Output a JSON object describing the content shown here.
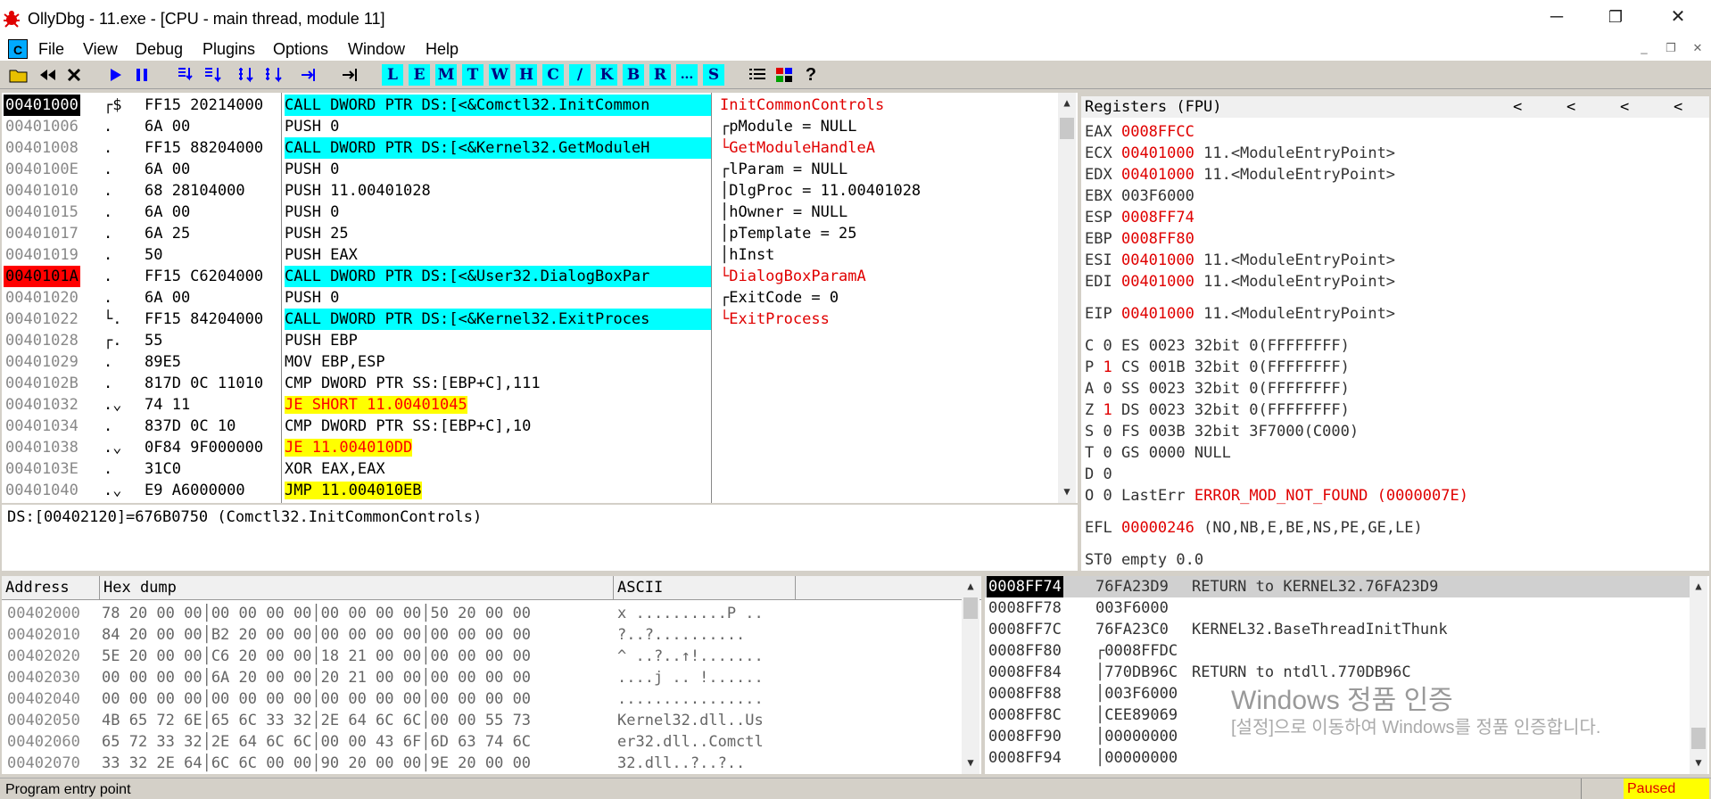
{
  "window": {
    "title": "OllyDbg - 11.exe - [CPU - main thread, module 11]",
    "minimize": "─",
    "restore": "❐",
    "close": "✕"
  },
  "menu": {
    "doc_icon": "C",
    "items": [
      "File",
      "View",
      "Debug",
      "Plugins",
      "Options",
      "Window",
      "Help"
    ],
    "mdi_min": "_",
    "mdi_restore": "❐",
    "mdi_close": "✕"
  },
  "toolbar": {
    "letters": [
      "L",
      "E",
      "M",
      "T",
      "W",
      "H",
      "C",
      "/",
      "K",
      "B",
      "R",
      "...",
      "S"
    ],
    "help": "?"
  },
  "cpu": {
    "rows": [
      {
        "addr": "00401000",
        "br": "┌$",
        "hex": "FF15 20214000",
        "dis": "CALL DWORD PTR DS:[<&Comctl32.InitCommon",
        "cmt": "InitCommonControls",
        "style": "call",
        "sel": true,
        "api": true
      },
      {
        "addr": "00401006",
        "br": ".",
        "hex": "6A 00",
        "dis": "PUSH 0",
        "cmt": "┌pModule = NULL",
        "style": "",
        "api": false
      },
      {
        "addr": "00401008",
        "br": ".",
        "hex": "FF15 88204000",
        "dis": "CALL DWORD PTR DS:[<&Kernel32.GetModuleH",
        "cmt": "└GetModuleHandleA",
        "style": "call",
        "api": true
      },
      {
        "addr": "0040100E",
        "br": ".",
        "hex": "6A 00",
        "dis": "PUSH 0",
        "cmt": "┌lParam = NULL",
        "style": "",
        "api": false
      },
      {
        "addr": "00401010",
        "br": ".",
        "hex": "68 28104000",
        "dis": "PUSH 11.00401028",
        "cmt": "│DlgProc = 11.00401028",
        "style": "",
        "api": false
      },
      {
        "addr": "00401015",
        "br": ".",
        "hex": "6A 00",
        "dis": "PUSH 0",
        "cmt": "│hOwner = NULL",
        "style": "",
        "api": false
      },
      {
        "addr": "00401017",
        "br": ".",
        "hex": "6A 25",
        "dis": "PUSH 25",
        "cmt": "│pTemplate = 25",
        "style": "",
        "api": false
      },
      {
        "addr": "00401019",
        "br": ".",
        "hex": "50",
        "dis": "PUSH EAX",
        "cmt": "│hInst",
        "style": "",
        "api": false
      },
      {
        "addr": "0040101A",
        "br": ".",
        "hex": "FF15 C6204000",
        "dis": "CALL DWORD PTR DS:[<&User32.DialogBoxPar",
        "cmt": "└DialogBoxParamA",
        "style": "call",
        "bp": true,
        "api": true
      },
      {
        "addr": "00401020",
        "br": ".",
        "hex": "6A 00",
        "dis": "PUSH 0",
        "cmt": "┌ExitCode = 0",
        "style": "",
        "api": false
      },
      {
        "addr": "00401022",
        "br": "└.",
        "hex": "FF15 84204000",
        "dis": "CALL DWORD PTR DS:[<&Kernel32.ExitProces",
        "cmt": "└ExitProcess",
        "style": "call",
        "api": true
      },
      {
        "addr": "00401028",
        "br": "┌.",
        "hex": "55",
        "dis": "PUSH EBP",
        "cmt": "",
        "style": "",
        "api": false
      },
      {
        "addr": "00401029",
        "br": ".",
        "hex": "89E5",
        "dis": "MOV EBP,ESP",
        "cmt": "",
        "style": "",
        "api": false
      },
      {
        "addr": "0040102B",
        "br": ".",
        "hex": "817D 0C 11010",
        "dis": "CMP DWORD PTR SS:[EBP+C],111",
        "cmt": "",
        "style": "",
        "api": false
      },
      {
        "addr": "00401032",
        "br": ".⌄",
        "hex": "74 11",
        "dis": "JE SHORT 11.00401045",
        "cmt": "",
        "style": "jcc",
        "api": false
      },
      {
        "addr": "00401034",
        "br": ".",
        "hex": "837D 0C 10",
        "dis": "CMP DWORD PTR SS:[EBP+C],10",
        "cmt": "",
        "style": "",
        "api": false
      },
      {
        "addr": "00401038",
        "br": ".⌄",
        "hex": "0F84 9F000000",
        "dis": "JE 11.004010DD",
        "cmt": "",
        "style": "jcc",
        "api": false
      },
      {
        "addr": "0040103E",
        "br": ".",
        "hex": "31C0",
        "dis": "XOR EAX,EAX",
        "cmt": "",
        "style": "",
        "api": false
      },
      {
        "addr": "00401040",
        "br": ".⌄",
        "hex": "E9 A6000000",
        "dis": "JMP 11.004010EB",
        "cmt": "",
        "style": "jmp",
        "api": false
      }
    ],
    "info": "DS:[00402120]=676B0750 (Comctl32.InitCommonControls)"
  },
  "registers": {
    "header": "Registers (FPU)",
    "nav": [
      "<",
      "<",
      "<",
      "<"
    ],
    "lines": [
      {
        "name": "EAX",
        "val": "0008FFCC",
        "sym": "",
        "red": true
      },
      {
        "name": "ECX",
        "val": "00401000",
        "sym": "11.<ModuleEntryPoint>",
        "red": true
      },
      {
        "name": "EDX",
        "val": "00401000",
        "sym": "11.<ModuleEntryPoint>",
        "red": true
      },
      {
        "name": "EBX",
        "val": "003F6000",
        "sym": "",
        "red": false
      },
      {
        "name": "ESP",
        "val": "0008FF74",
        "sym": "",
        "red": true
      },
      {
        "name": "EBP",
        "val": "0008FF80",
        "sym": "",
        "red": true
      },
      {
        "name": "ESI",
        "val": "00401000",
        "sym": "11.<ModuleEntryPoint>",
        "red": true
      },
      {
        "name": "EDI",
        "val": "00401000",
        "sym": "11.<ModuleEntryPoint>",
        "red": true
      }
    ],
    "eip": {
      "name": "EIP",
      "val": "00401000",
      "sym": "11.<ModuleEntryPoint>"
    },
    "flags": [
      {
        "f": "C",
        "v": "0",
        "red": false,
        "seg": "ES 0023 32bit 0(FFFFFFFF)"
      },
      {
        "f": "P",
        "v": "1",
        "red": true,
        "seg": "CS 001B 32bit 0(FFFFFFFF)"
      },
      {
        "f": "A",
        "v": "0",
        "red": false,
        "seg": "SS 0023 32bit 0(FFFFFFFF)"
      },
      {
        "f": "Z",
        "v": "1",
        "red": true,
        "seg": "DS 0023 32bit 0(FFFFFFFF)"
      },
      {
        "f": "S",
        "v": "0",
        "red": false,
        "seg": "FS 003B 32bit 3F7000(C000)"
      },
      {
        "f": "T",
        "v": "0",
        "red": false,
        "seg": "GS 0000 NULL"
      },
      {
        "f": "D",
        "v": "0",
        "red": false,
        "seg": ""
      },
      {
        "f": "O",
        "v": "0",
        "red": false,
        "seg": "LastErr"
      }
    ],
    "lasterr": "ERROR_MOD_NOT_FOUND (0000007E)",
    "efl": {
      "name": "EFL",
      "val": "00000246",
      "sym": "(NO,NB,E,BE,NS,PE,GE,LE)"
    },
    "st0": "ST0 empty 0.0"
  },
  "dump": {
    "headers": [
      "Address",
      "Hex dump",
      "ASCII"
    ],
    "rows": [
      {
        "addr": "00402000",
        "hex": "78 20 00 00│00 00 00 00│00 00 00 00│50 20 00 00",
        "ascii": "x ..........P .."
      },
      {
        "addr": "00402010",
        "hex": "84 20 00 00│B2 20 00 00│00 00 00 00│00 00 00 00",
        "ascii": "?..?.........."
      },
      {
        "addr": "00402020",
        "hex": "5E 20 00 00│C6 20 00 00│18 21 00 00│00 00 00 00",
        "ascii": "^ ..?..↑!......."
      },
      {
        "addr": "00402030",
        "hex": "00 00 00 00│6A 20 00 00│20 21 00 00│00 00 00 00",
        "ascii": "....j .. !......"
      },
      {
        "addr": "00402040",
        "hex": "00 00 00 00│00 00 00 00│00 00 00 00│00 00 00 00",
        "ascii": "................"
      },
      {
        "addr": "00402050",
        "hex": "4B 65 72 6E│65 6C 33 32│2E 64 6C 6C│00 00 55 73",
        "ascii": "Kernel32.dll..Us"
      },
      {
        "addr": "00402060",
        "hex": "65 72 33 32│2E 64 6C 6C│00 00 43 6F│6D 63 74 6C",
        "ascii": "er32.dll..Comctl"
      },
      {
        "addr": "00402070",
        "hex": "33 32 2E 64│6C 6C 00 00│90 20 00 00│9E 20 00 00",
        "ascii": "32.dll..?..?.."
      }
    ]
  },
  "stack": {
    "rows": [
      {
        "addr": "0008FF74",
        "val": "76FA23D9",
        "cmt": "RETURN to KERNEL32.76FA23D9",
        "sel": true
      },
      {
        "addr": "0008FF78",
        "val": "003F6000",
        "cmt": ""
      },
      {
        "addr": "0008FF7C",
        "val": "76FA23C0",
        "cmt": "KERNEL32.BaseThreadInitThunk"
      },
      {
        "addr": "0008FF80",
        "val": "┌0008FFDC",
        "cmt": ""
      },
      {
        "addr": "0008FF84",
        "val": "│770DB96C",
        "cmt": "RETURN to ntdll.770DB96C"
      },
      {
        "addr": "0008FF88",
        "val": "│003F6000",
        "cmt": ""
      },
      {
        "addr": "0008FF8C",
        "val": "│CEE89069",
        "cmt": ""
      },
      {
        "addr": "0008FF90",
        "val": "│00000000",
        "cmt": ""
      },
      {
        "addr": "0008FF94",
        "val": "│00000000",
        "cmt": ""
      }
    ]
  },
  "watermark": {
    "title": "Windows 정품 인증",
    "text": "[설정]으로 이동하여 Windows를 정품 인증합니다."
  },
  "status": {
    "text": "Program entry point",
    "state": "Paused"
  },
  "colors": {
    "accent_call": "#00ffff",
    "jump": "#ffff00",
    "red": "#e00000"
  }
}
